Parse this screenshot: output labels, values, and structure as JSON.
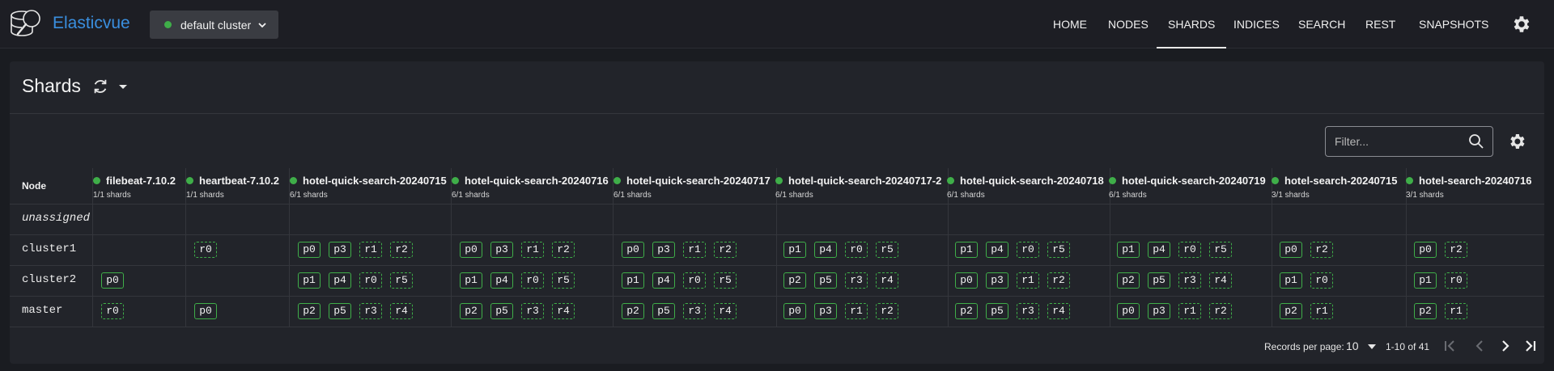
{
  "app": {
    "brand": "Elasticvue",
    "cluster_label": "default cluster"
  },
  "nav": [
    "HOME",
    "NODES",
    "SHARDS",
    "INDICES",
    "SEARCH",
    "REST",
    "SNAPSHOTS"
  ],
  "nav_active": "SHARDS",
  "page": {
    "title": "Shards",
    "filter_placeholder": "Filter...",
    "node_header": "Node"
  },
  "indices": [
    {
      "name": "filebeat-7.10.2",
      "shards": "1/1 shards"
    },
    {
      "name": "heartbeat-7.10.2",
      "shards": "1/1 shards"
    },
    {
      "name": "hotel-quick-search-20240715",
      "shards": "6/1 shards"
    },
    {
      "name": "hotel-quick-search-20240716",
      "shards": "6/1 shards"
    },
    {
      "name": "hotel-quick-search-20240717",
      "shards": "6/1 shards"
    },
    {
      "name": "hotel-quick-search-20240717-2",
      "shards": "6/1 shards"
    },
    {
      "name": "hotel-quick-search-20240718",
      "shards": "6/1 shards"
    },
    {
      "name": "hotel-quick-search-20240719",
      "shards": "6/1 shards"
    },
    {
      "name": "hotel-search-20240715",
      "shards": "3/1 shards"
    },
    {
      "name": "hotel-search-20240716",
      "shards": "3/1 shards"
    }
  ],
  "rows": [
    {
      "node": "unassigned",
      "cells": [
        [],
        [],
        [],
        [],
        [],
        [],
        [],
        [],
        [],
        []
      ]
    },
    {
      "node": "cluster1",
      "cells": [
        [],
        [
          "r0"
        ],
        [
          "p0",
          "p3",
          "r1",
          "r2"
        ],
        [
          "p0",
          "p3",
          "r1",
          "r2"
        ],
        [
          "p0",
          "p3",
          "r1",
          "r2"
        ],
        [
          "p1",
          "p4",
          "r0",
          "r5"
        ],
        [
          "p1",
          "p4",
          "r0",
          "r5"
        ],
        [
          "p1",
          "p4",
          "r0",
          "r5"
        ],
        [
          "p0",
          "r2"
        ],
        [
          "p0",
          "r2"
        ]
      ]
    },
    {
      "node": "cluster2",
      "cells": [
        [
          "p0"
        ],
        [],
        [
          "p1",
          "p4",
          "r0",
          "r5"
        ],
        [
          "p1",
          "p4",
          "r0",
          "r5"
        ],
        [
          "p1",
          "p4",
          "r0",
          "r5"
        ],
        [
          "p2",
          "p5",
          "r3",
          "r4"
        ],
        [
          "p0",
          "p3",
          "r1",
          "r2"
        ],
        [
          "p2",
          "p5",
          "r3",
          "r4"
        ],
        [
          "p1",
          "r0"
        ],
        [
          "p1",
          "r0"
        ]
      ]
    },
    {
      "node": "master",
      "cells": [
        [
          "r0"
        ],
        [
          "p0"
        ],
        [
          "p2",
          "p5",
          "r3",
          "r4"
        ],
        [
          "p2",
          "p5",
          "r3",
          "r4"
        ],
        [
          "p2",
          "p5",
          "r3",
          "r4"
        ],
        [
          "p0",
          "p3",
          "r1",
          "r2"
        ],
        [
          "p2",
          "p5",
          "r3",
          "r4"
        ],
        [
          "p0",
          "p3",
          "r1",
          "r2"
        ],
        [
          "p2",
          "r1"
        ],
        [
          "p2",
          "r1"
        ]
      ]
    }
  ],
  "pagination": {
    "records_label": "Records per page:",
    "per_page": "10",
    "range": "1-10 of 41"
  },
  "colors": {
    "accent": "#3a8fdf",
    "health_green": "#3fae49"
  }
}
